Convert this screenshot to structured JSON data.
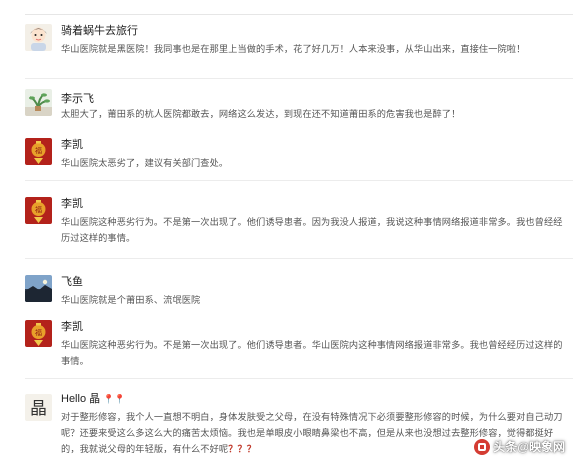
{
  "comments": [
    {
      "user": "骑着蜗牛去旅行",
      "text": "华山医院就是黑医院！我同事也是在那里上当做的手术，花了好几万！人本来没事，从华山出来，直接住一院啦！",
      "avatar": "cartoon-face-avatar"
    },
    {
      "user": "李示飞",
      "text": "太胆大了，莆田系的杭人医院都敢去，网络这么发达，到现在还不知道莆田系的危害我也是醉了！",
      "avatar": "plant-avatar"
    },
    {
      "user": "李凯",
      "text": "华山医院太恶劣了，建议有关部门查处。",
      "avatar": "red-lantern-avatar"
    },
    {
      "user": "李凯",
      "text": "华山医院这种恶劣行为。不是第一次出现了。他们诱导患者。因为我没人报道，我说这种事情网络报道非常多。我也曾经经历过这样的事情。",
      "avatar": "red-lantern-avatar"
    },
    {
      "user": "飞鱼",
      "text": "华山医院就是个莆田系、流氓医院",
      "avatar": "sky-avatar"
    },
    {
      "user": "李凯",
      "text": "华山医院这种恶劣行为。不是第一次出现了。他们诱导患者。华山医院内这种事情网络报道非常多。我也曾经经历过这样的事情。",
      "avatar": "red-lantern-avatar"
    },
    {
      "user": "Hello 晶",
      "user_suffix": "📍📍",
      "text": "对于整形修容，我个人一直想不明白，身体发肤受之父母，在没有特殊情况下必须要整形修容的时候，为什么要对自己动刀呢？还要来受这么多这么大的痛苦太烦恼。我也是单眼皮小眼睛鼻梁也不高，但是从来也没想过去整形修容，觉得都挺好的，我就说父母的年轻版，有什么不好呢",
      "text_suffix": "？？？",
      "avatar": "calligraphy-avatar"
    }
  ],
  "watermark": {
    "text": "头条@映象网",
    "icon": "toutiao-icon"
  }
}
